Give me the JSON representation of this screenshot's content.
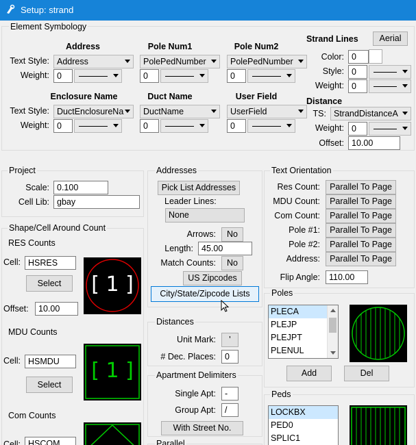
{
  "window": {
    "title": "Setup: strand"
  },
  "element_symbology": {
    "group": "Element Symbology",
    "text_style_label": "Text Style:",
    "weight_label": "Weight:",
    "columns": [
      {
        "header": "Address",
        "text_style": "Address",
        "weight": "0"
      },
      {
        "header": "Pole Num1",
        "text_style": "PolePedNumber",
        "weight": "0"
      },
      {
        "header": "Pole Num2",
        "text_style": "PolePedNumber",
        "weight": "0"
      },
      {
        "header": "Enclosure Name",
        "text_style": "DuctEnclosureNa",
        "weight": "0"
      },
      {
        "header": "Duct Name",
        "text_style": "DuctName",
        "weight": "0"
      },
      {
        "header": "User Field",
        "text_style": "UserField",
        "weight": "0"
      }
    ],
    "strand_lines": {
      "header": "Strand Lines",
      "aerial_button": "Aerial",
      "color_label": "Color:",
      "color": "0",
      "style_label": "Style:",
      "style": "0",
      "weight_label": "Weight:",
      "weight": "0"
    },
    "distance": {
      "header": "Distance",
      "ts_label": "TS:",
      "ts": "StrandDistanceA",
      "weight_label": "Weight:",
      "weight": "0",
      "offset_label": "Offset:",
      "offset": "10.00"
    }
  },
  "project": {
    "group": "Project",
    "scale_label": "Scale:",
    "scale": "0.100",
    "cell_lib_label": "Cell Lib:",
    "cell_lib": "gbay"
  },
  "shape_cell": {
    "group": "Shape/Cell Around Count",
    "res": {
      "title": "RES Counts",
      "cell_label": "Cell:",
      "cell": "HSRES",
      "select": "Select",
      "offset_label": "Offset:",
      "offset": "10.00",
      "preview": "[ 1 ]"
    },
    "mdu": {
      "title": "MDU Counts",
      "cell_label": "Cell:",
      "cell": "HSMDU",
      "select": "Select",
      "preview": "[ 1 ]"
    },
    "com": {
      "title": "Com Counts",
      "cell_label": "Cell:",
      "cell": "HSCOM"
    }
  },
  "addresses": {
    "group": "Addresses",
    "pick_list": "Pick List Addresses",
    "leader_lines_label": "Leader Lines:",
    "leader_lines": "None",
    "arrows_label": "Arrows:",
    "arrows": "No",
    "length_label": "Length:",
    "length": "45.00",
    "match_counts_label": "Match Counts:",
    "match_counts": "No",
    "us_zipcodes": "US Zipcodes",
    "city_state_zip": "City/State/Zipcode Lists"
  },
  "distances": {
    "group": "Distances",
    "unit_mark_label": "Unit Mark:",
    "unit_mark": "'",
    "dec_places_label": "# Dec. Places:",
    "dec_places": "0"
  },
  "apartment": {
    "group": "Apartment Delimiters",
    "single_label": "Single Apt:",
    "single": "-",
    "group_label": "Group Apt:",
    "group_val": "/",
    "with_street": "With Street No."
  },
  "parallel": {
    "group": "Parallel"
  },
  "text_orientation": {
    "group": "Text Orientation",
    "rows": [
      {
        "label": "Res Count:",
        "value": "Parallel To Page"
      },
      {
        "label": "MDU Count:",
        "value": "Parallel To Page"
      },
      {
        "label": "Com Count:",
        "value": "Parallel To Page"
      },
      {
        "label": "Pole #1:",
        "value": "Parallel To Page"
      },
      {
        "label": "Pole #2:",
        "value": "Parallel To Page"
      },
      {
        "label": "Address:",
        "value": "Parallel To Page"
      }
    ],
    "flip_label": "Flip Angle:",
    "flip": "110.00"
  },
  "poles": {
    "group": "Poles",
    "items": [
      "PLECA",
      "PLEJP",
      "PLEJPT",
      "PLENUL"
    ],
    "add": "Add",
    "del": "Del"
  },
  "peds": {
    "group": "Peds",
    "items": [
      "LOCKBX",
      "PED0",
      "SPLIC1"
    ]
  },
  "colors": {
    "titlebar": "#1683d8",
    "preview_green": "#00cc00",
    "preview_red": "#e00000",
    "selection": "#cce8ff"
  }
}
